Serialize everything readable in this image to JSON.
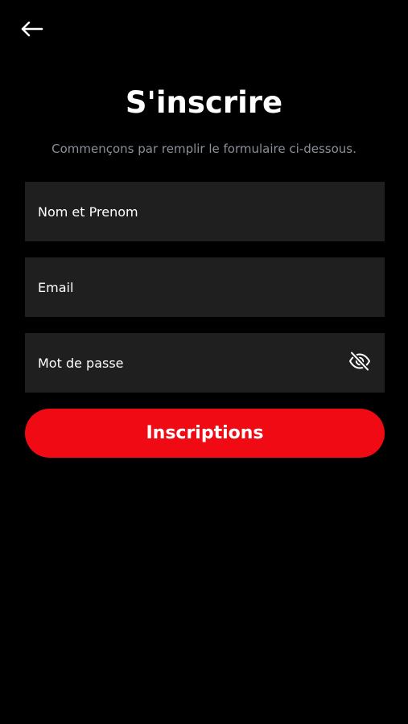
{
  "header": {
    "back_icon": "arrow-left-icon"
  },
  "page": {
    "title": "S'inscrire",
    "subtitle": "Commençons par remplir le formulaire ci-dessous."
  },
  "form": {
    "name_field": {
      "placeholder": "Nom et Prenom",
      "value": ""
    },
    "email_field": {
      "placeholder": "Email",
      "value": ""
    },
    "password_field": {
      "placeholder": "Mot de passe",
      "value": "",
      "toggle_icon": "eye-off-icon"
    },
    "submit_label": "Inscriptions"
  },
  "colors": {
    "background": "#000000",
    "field_background": "#1f1f1f",
    "accent": "#f00a14",
    "subtitle_text": "#8a8f98",
    "text": "#ffffff"
  }
}
